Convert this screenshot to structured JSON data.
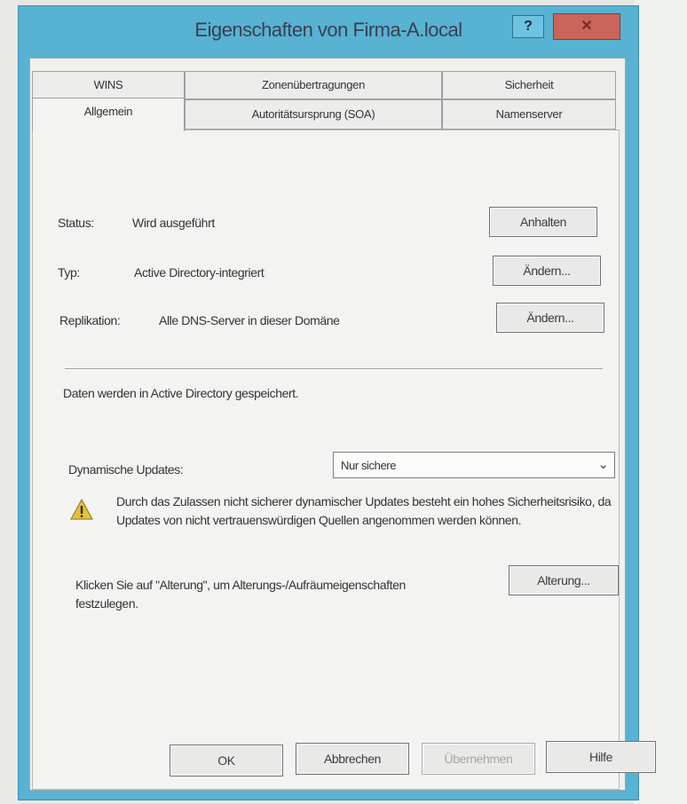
{
  "window": {
    "title": "Eigenschaften von Firma-A.local",
    "help_label": "?",
    "close_label": "✕"
  },
  "tabs": {
    "row1": [
      "WINS",
      "Zonenübertragungen",
      "Sicherheit"
    ],
    "row2": [
      "Allgemein",
      "Autoritätsursprung (SOA)",
      "Namenserver"
    ],
    "active": "Allgemein"
  },
  "general": {
    "status_label": "Status:",
    "status_value": "Wird ausgeführt",
    "status_button": "Anhalten",
    "type_label": "Typ:",
    "type_value": "Active Directory-integriert",
    "type_button": "Ändern...",
    "replication_label": "Replikation:",
    "replication_value": "Alle DNS-Server in dieser Domäne",
    "replication_button": "Ändern...",
    "storage_text": "Daten werden in Active Directory gespeichert.",
    "dynamic_updates_label": "Dynamische Updates:",
    "dynamic_updates_value": "Nur sichere",
    "warning_text": "Durch das Zulassen nicht sicherer dynamischer Updates besteht ein hohes Sicherheitsrisiko, da Updates von nicht vertrauenswürdigen Quellen angenommen werden können.",
    "aging_hint": "Klicken Sie auf \"Alterung\", um Alterungs-/Aufräumeigenschaften festzulegen.",
    "aging_button": "Alterung..."
  },
  "footer": {
    "ok": "OK",
    "cancel": "Abbrechen",
    "apply": "Übernehmen",
    "help": "Hilfe"
  },
  "colors": {
    "frame": "#58b2d2",
    "close_button": "#c9645a",
    "warning_icon": "#e2c23a"
  }
}
